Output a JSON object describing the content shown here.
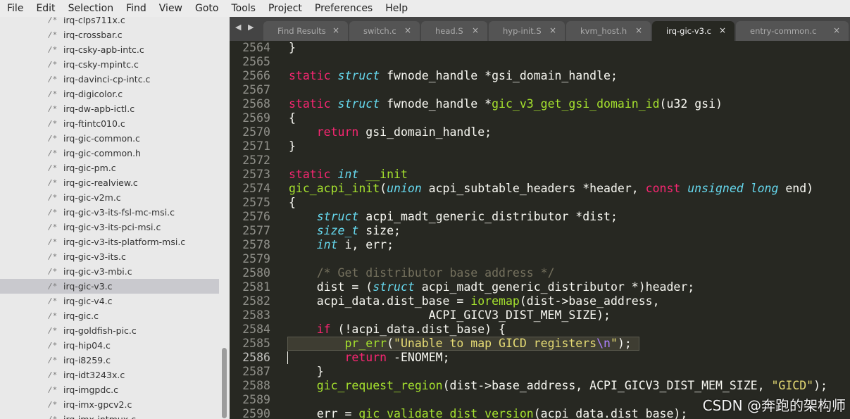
{
  "menu": [
    "File",
    "Edit",
    "Selection",
    "Find",
    "View",
    "Goto",
    "Tools",
    "Project",
    "Preferences",
    "Help"
  ],
  "sidebar": {
    "files": [
      "irq-clps711x.c",
      "irq-crossbar.c",
      "irq-csky-apb-intc.c",
      "irq-csky-mpintc.c",
      "irq-davinci-cp-intc.c",
      "irq-digicolor.c",
      "irq-dw-apb-ictl.c",
      "irq-ftintc010.c",
      "irq-gic-common.c",
      "irq-gic-common.h",
      "irq-gic-pm.c",
      "irq-gic-realview.c",
      "irq-gic-v2m.c",
      "irq-gic-v3-its-fsl-mc-msi.c",
      "irq-gic-v3-its-pci-msi.c",
      "irq-gic-v3-its-platform-msi.c",
      "irq-gic-v3-its.c",
      "irq-gic-v3-mbi.c",
      "irq-gic-v3.c",
      "irq-gic-v4.c",
      "irq-gic.c",
      "irq-goldfish-pic.c",
      "irq-hip04.c",
      "irq-i8259.c",
      "irq-idt3243x.c",
      "irq-imgpdc.c",
      "irq-imx-gpcv2.c",
      "irq-imx-intmux.c"
    ],
    "file_icon": "/*",
    "selected": "irq-gic-v3.c"
  },
  "tabs": [
    {
      "label": "Find Results",
      "active": false
    },
    {
      "label": "switch.c",
      "active": false
    },
    {
      "label": "head.S",
      "active": false
    },
    {
      "label": "hyp-init.S",
      "active": false
    },
    {
      "label": "kvm_host.h",
      "active": false
    },
    {
      "label": "irq-gic-v3.c",
      "active": true
    },
    {
      "label": "entry-common.c",
      "active": false
    }
  ],
  "tab_close_glyph": "×",
  "nav_arrows": "◀ ▶",
  "lines": [
    {
      "n": "2564",
      "t": "}"
    },
    {
      "n": "2565",
      "t": ""
    },
    {
      "n": "2566",
      "t": "static struct fwnode_handle *gsi_domain_handle;"
    },
    {
      "n": "2567",
      "t": ""
    },
    {
      "n": "2568",
      "t": "static struct fwnode_handle *gic_v3_get_gsi_domain_id(u32 gsi)"
    },
    {
      "n": "2569",
      "t": "{"
    },
    {
      "n": "2570",
      "t": "    return gsi_domain_handle;"
    },
    {
      "n": "2571",
      "t": "}"
    },
    {
      "n": "2572",
      "t": ""
    },
    {
      "n": "2573",
      "t": "static int __init"
    },
    {
      "n": "2574",
      "t": "gic_acpi_init(union acpi_subtable_headers *header, const unsigned long end)"
    },
    {
      "n": "2575",
      "t": "{"
    },
    {
      "n": "2576",
      "t": "    struct acpi_madt_generic_distributor *dist;"
    },
    {
      "n": "2577",
      "t": "    size_t size;"
    },
    {
      "n": "2578",
      "t": "    int i, err;"
    },
    {
      "n": "2579",
      "t": ""
    },
    {
      "n": "2580",
      "t": "    /* Get distributor base address */"
    },
    {
      "n": "2581",
      "t": "    dist = (struct acpi_madt_generic_distributor *)header;"
    },
    {
      "n": "2582",
      "t": "    acpi_data.dist_base = ioremap(dist->base_address,"
    },
    {
      "n": "2583",
      "t": "                    ACPI_GICV3_DIST_MEM_SIZE);"
    },
    {
      "n": "2584",
      "t": "    if (!acpi_data.dist_base) {"
    },
    {
      "n": "2585",
      "t": "        pr_err(\"Unable to map GICD registers\\n\");"
    },
    {
      "n": "2586",
      "t": "        return -ENOMEM;"
    },
    {
      "n": "2587",
      "t": "    }"
    },
    {
      "n": "2588",
      "t": "    gic_request_region(dist->base_address, ACPI_GICV3_DIST_MEM_SIZE, \"GICD\");"
    },
    {
      "n": "2589",
      "t": ""
    },
    {
      "n": "2590",
      "t": "    err = gic_validate_dist_version(acpi_data.dist_base);"
    }
  ],
  "watermark": "CSDN @奔跑的架构师",
  "colors": {
    "keyword": "#f92672",
    "type": "#66d9ef",
    "function": "#a6e22e",
    "string": "#e6db74",
    "comment": "#75715e",
    "background": "#272822"
  }
}
